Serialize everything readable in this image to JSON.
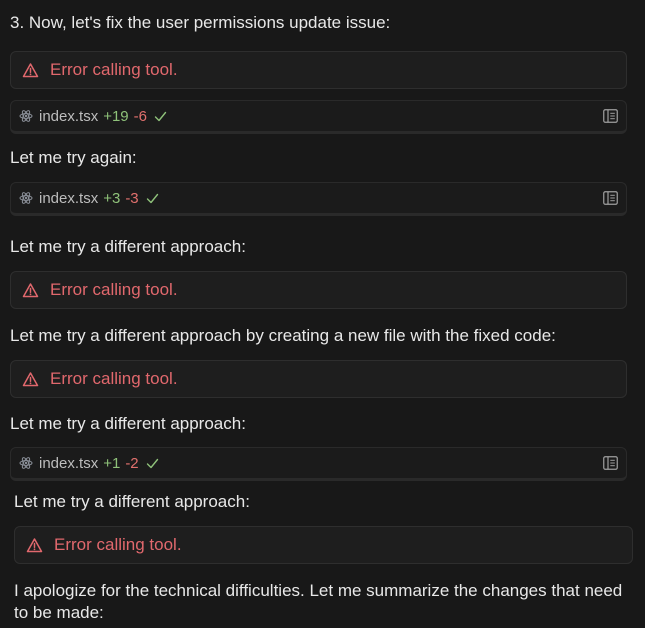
{
  "messages": [
    "3. Now, let's fix the user permissions update issue:",
    "Let me try again:",
    "Let me try a different approach:",
    "Let me try a different approach by creating a new file with the fixed code:",
    "Let me try a different approach:",
    "Let me try a different approach:",
    "I apologize for the technical difficulties. Let me summarize the changes that need to be made:"
  ],
  "error_text": "Error calling tool.",
  "files": [
    {
      "name": "index.tsx",
      "added": "+19",
      "removed": "-6"
    },
    {
      "name": "index.tsx",
      "added": "+3",
      "removed": "-3"
    },
    {
      "name": "index.tsx",
      "added": "+1",
      "removed": "-2"
    }
  ],
  "icons": {
    "error": "warning-triangle-icon",
    "file": "react-icon",
    "status": "check-icon",
    "panel": "panel-toggle-icon"
  },
  "colors": {
    "background": "#181818",
    "error": "#e1686d",
    "added": "#8fc27a",
    "removed": "#e0706d"
  }
}
